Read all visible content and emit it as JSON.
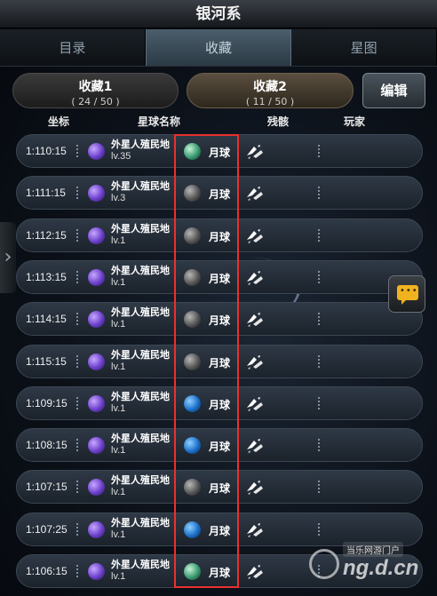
{
  "title": "银河系",
  "tabs": [
    {
      "label": "目录",
      "active": false
    },
    {
      "label": "收藏",
      "active": true
    },
    {
      "label": "星图",
      "active": false
    }
  ],
  "favorites": [
    {
      "label": "收藏1",
      "count": "( 24 / 50 )",
      "selected": false
    },
    {
      "label": "收藏2",
      "count": "( 11 / 50 )",
      "selected": true
    }
  ],
  "edit_label": "编辑",
  "columns": {
    "coord": "坐标",
    "planet": "星球名称",
    "wreck": "残骸",
    "player": "玩家"
  },
  "rows": [
    {
      "coord": "1:110:15",
      "planet": "外星人殖民地",
      "level": "lv.35",
      "moon": "月球",
      "moon_color": "teal"
    },
    {
      "coord": "1:111:15",
      "planet": "外星人殖民地",
      "level": "lv.3",
      "moon": "月球",
      "moon_color": "grey"
    },
    {
      "coord": "1:112:15",
      "planet": "外星人殖民地",
      "level": "lv.1",
      "moon": "月球",
      "moon_color": "grey"
    },
    {
      "coord": "1:113:15",
      "planet": "外星人殖民地",
      "level": "lv.1",
      "moon": "月球",
      "moon_color": "grey"
    },
    {
      "coord": "1:114:15",
      "planet": "外星人殖民地",
      "level": "lv.1",
      "moon": "月球",
      "moon_color": "grey"
    },
    {
      "coord": "1:115:15",
      "planet": "外星人殖民地",
      "level": "lv.1",
      "moon": "月球",
      "moon_color": "grey"
    },
    {
      "coord": "1:109:15",
      "planet": "外星人殖民地",
      "level": "lv.1",
      "moon": "月球",
      "moon_color": "blue"
    },
    {
      "coord": "1:108:15",
      "planet": "外星人殖民地",
      "level": "lv.1",
      "moon": "月球",
      "moon_color": "blue"
    },
    {
      "coord": "1:107:15",
      "planet": "外星人殖民地",
      "level": "lv.1",
      "moon": "月球",
      "moon_color": "grey"
    },
    {
      "coord": "1:107:25",
      "planet": "外星人殖民地",
      "level": "lv.1",
      "moon": "月球",
      "moon_color": "blue"
    },
    {
      "coord": "1:106:15",
      "planet": "外星人殖民地",
      "level": "lv.1",
      "moon": "月球",
      "moon_color": "teal"
    }
  ],
  "watermark": {
    "small": "当乐网游门户",
    "big": "ng.d.cn"
  },
  "icons": {
    "planet": "purple-planet-icon",
    "moon": "moon-icon",
    "wreck": "spaceship-icon",
    "side": "chevron-right-icon",
    "chat": "chat-bubble-icon"
  }
}
